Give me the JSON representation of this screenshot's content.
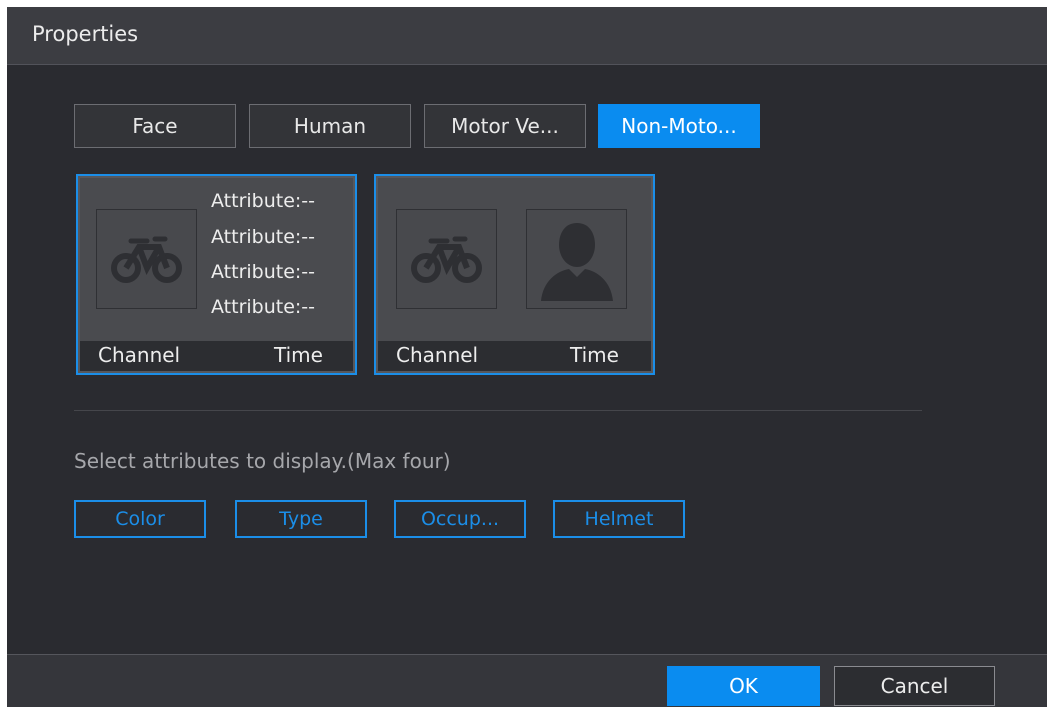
{
  "dialog": {
    "title": "Properties"
  },
  "tabs": [
    {
      "label": "Face",
      "active": false
    },
    {
      "label": "Human",
      "active": false
    },
    {
      "label": "Motor Ve...",
      "active": false
    },
    {
      "label": "Non-Moto...",
      "active": true
    }
  ],
  "cards": [
    {
      "attributes": [
        "Attribute:--",
        "Attribute:--",
        "Attribute:--",
        "Attribute:--"
      ],
      "channel_label": "Channel",
      "time_label": "Time"
    },
    {
      "channel_label": "Channel",
      "time_label": "Time"
    }
  ],
  "hint": "Select attributes to display.(Max four)",
  "attribute_buttons": [
    "Color",
    "Type",
    "Occup...",
    "Helmet"
  ],
  "footer": {
    "ok_label": "OK",
    "cancel_label": "Cancel"
  },
  "colors": {
    "accent": "#0a8cf0",
    "background": "#2a2b30",
    "titlebar": "#3c3d42"
  },
  "icons": {
    "vehicle_placeholder": "bicycle-icon",
    "person_placeholder": "person-silhouette-icon"
  }
}
